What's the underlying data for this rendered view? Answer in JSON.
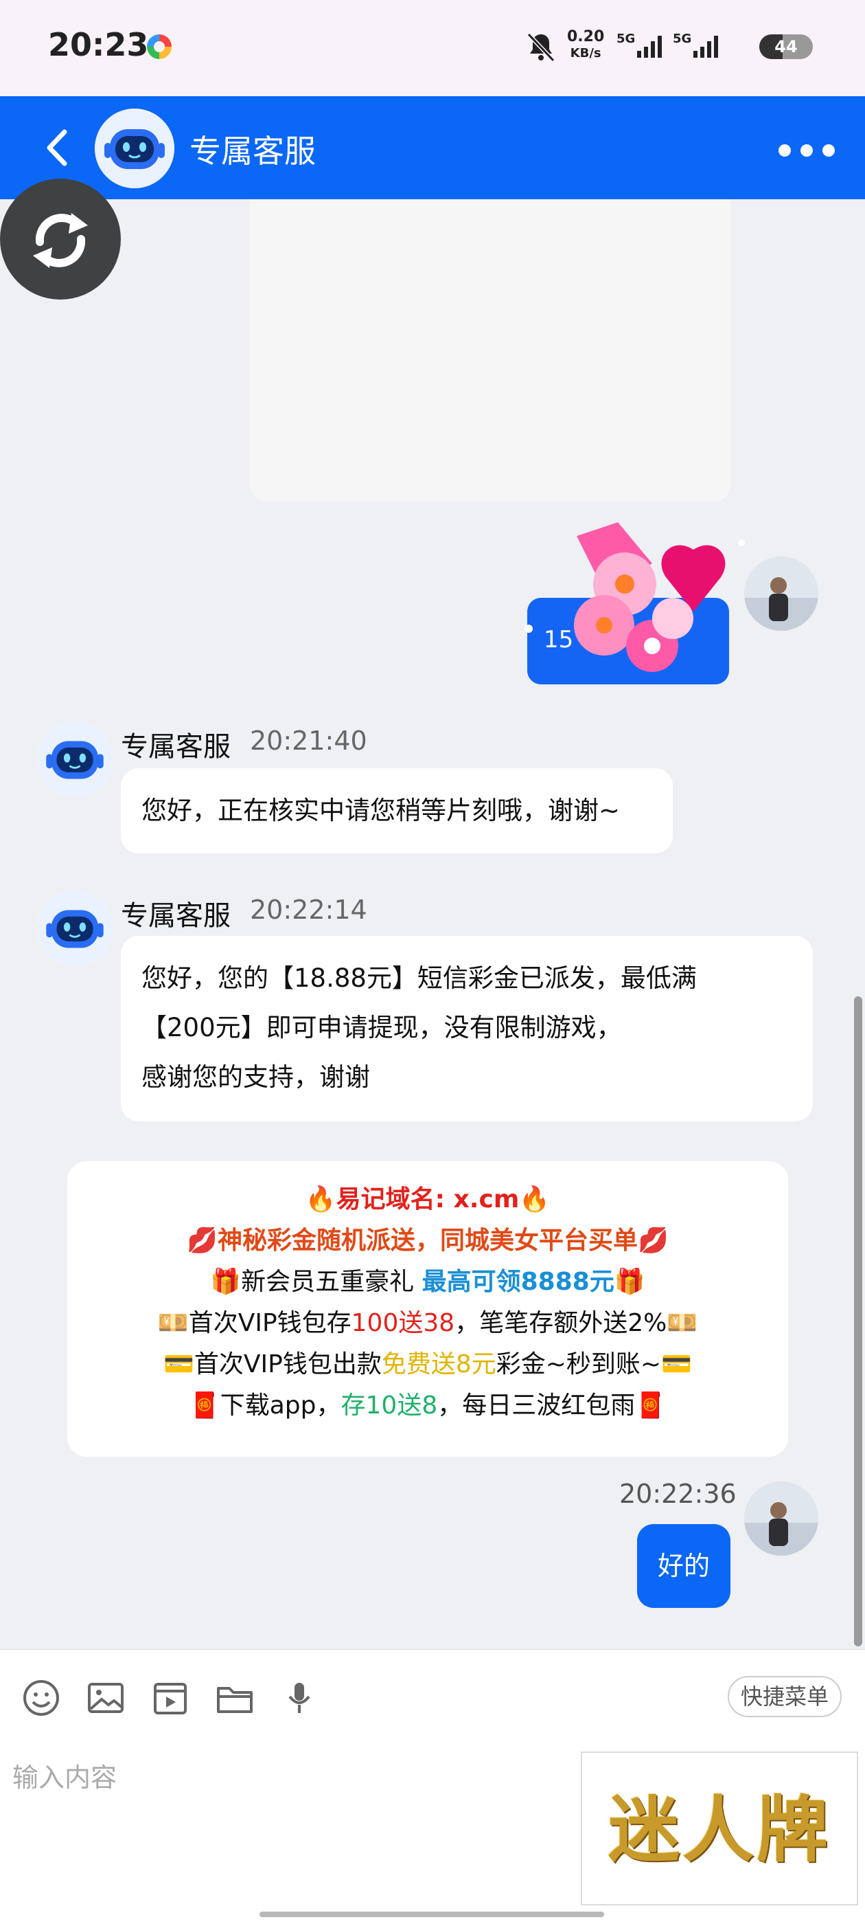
{
  "status_bar": {
    "time": "20:23",
    "speed_value": "0.20",
    "speed_unit": "KB/s",
    "signal_1": "5G",
    "signal_2": "5G",
    "battery": "44",
    "battery_level": 0.44
  },
  "header": {
    "title": "专属客服",
    "back_icon": "chevron-left-icon",
    "more_icon": "more-dots-icon"
  },
  "sticker": {
    "badge": "15"
  },
  "messages": [
    {
      "name": "专属客服",
      "time": "20:21:40",
      "text": "您好，正在核实中请您稍等片刻哦，谢谢~"
    },
    {
      "name": "专属客服",
      "time": "20:22:14",
      "lines": [
        "您好，您的【18.88元】短信彩金已派发，最低满",
        "【200元】即可申请提现，没有限制游戏，",
        "感谢您的支持，谢谢"
      ]
    }
  ],
  "promo": {
    "line1": "🔥易记域名: x.cm🔥",
    "line2": "💋神秘彩金随机派送，同城美女平台买单💋",
    "line3_a": "🎁新会员五重豪礼 ",
    "line3_b": "最高可领8888元",
    "line3_c": "🎁",
    "line4_a": "💴首次VIP钱包存",
    "line4_b": "100送38",
    "line4_c": "，笔笔存额外送2%💴",
    "line5_a": "💳首次VIP钱包出款",
    "line5_b": "免费送8元",
    "line5_c": "彩金~秒到账~💳",
    "line6_a": "🧧下载app，",
    "line6_b": "存10送8",
    "line6_c": "，每日三波红包雨🧧"
  },
  "user_reply": {
    "time": "20:22:36",
    "text": "好的"
  },
  "input": {
    "placeholder": "输入内容",
    "quick_menu": "快捷菜单",
    "tools": [
      "emoji-icon",
      "image-icon",
      "video-icon",
      "folder-icon",
      "microphone-icon"
    ]
  },
  "brand": {
    "text": "迷人牌"
  }
}
